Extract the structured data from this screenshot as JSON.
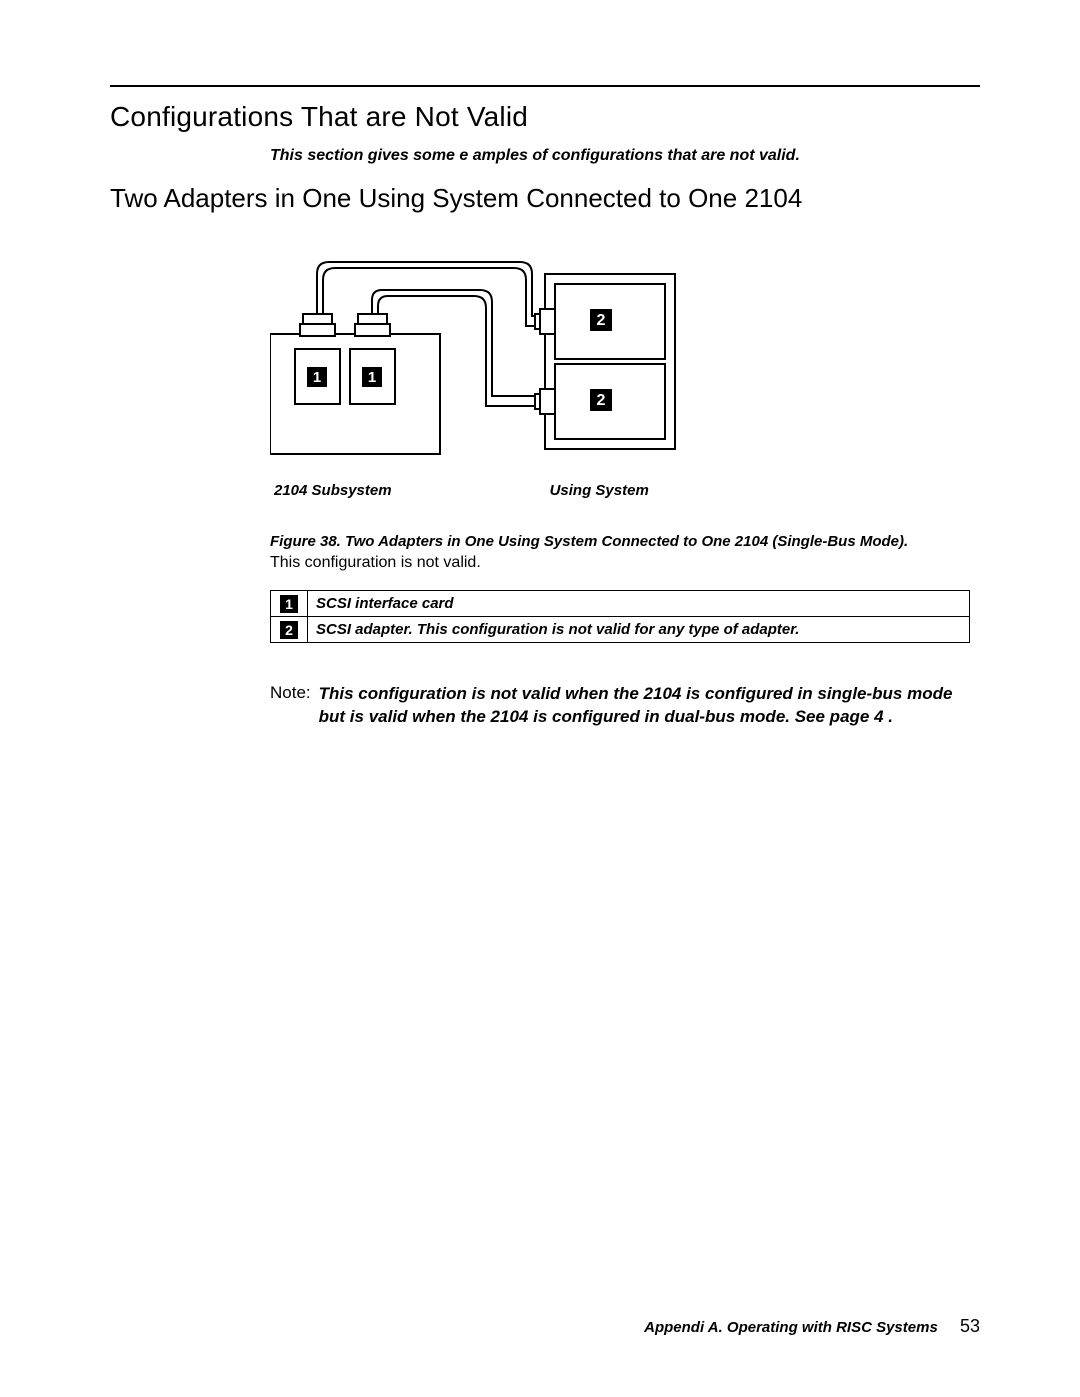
{
  "headings": {
    "h1": "Configurations That are Not Valid",
    "intro": "This section gives some e  amples of configurations that are not valid.",
    "h2": "Two Adapters in One Using System Connected to One 2104"
  },
  "diagram": {
    "callout1": "1",
    "callout2": "2",
    "label_left": "2104 Subsystem",
    "label_right": "Using System"
  },
  "figure": {
    "lead": "Figure 38. Two Adapters in One Using System Connected to One 2104 (Single-Bus Mode).",
    "after": "This configuration is not valid."
  },
  "legend": {
    "rows": [
      {
        "n": "1",
        "text": "SCSI interface card"
      },
      {
        "n": "2",
        "text": "SCSI adapter. This configuration is not valid for any type of adapter."
      }
    ]
  },
  "note": {
    "label": "Note:",
    "body": "This configuration is not valid when the 2104 is configured in single-bus mode  but is valid when the 2104 is configured in dual-bus mode. See page 4  ."
  },
  "footer": {
    "appendix": "Appendi  A. Operating with RISC Systems",
    "page": "53"
  }
}
